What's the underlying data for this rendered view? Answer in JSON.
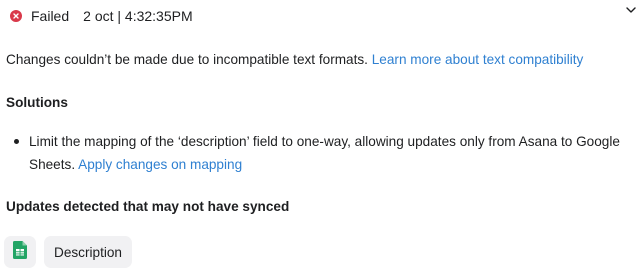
{
  "status": {
    "icon": "failed-x-icon",
    "label": "Failed",
    "timestamp": "2 oct | 4:32:35PM",
    "color": "#d9394a"
  },
  "expand_icon": "chevron-down-icon",
  "message": {
    "text": "Changes couldn’t be made due to incompatible text formats.",
    "link": "Learn more about text compatibility"
  },
  "solutions": {
    "heading": "Solutions",
    "items": [
      {
        "text": "Limit the mapping of the ‘description’ field to one-way, allowing updates only from Asana to Google Sheets.",
        "link": "Apply changes on mapping"
      }
    ]
  },
  "updates": {
    "heading": "Updates detected that may not have synced",
    "app_icon": "google-sheets-icon",
    "field_label": "Description"
  },
  "colors": {
    "link": "#2f80d1",
    "text": "#1e1f21",
    "chip_background": "#f1f1f3",
    "sheets_green": "#23a566"
  }
}
